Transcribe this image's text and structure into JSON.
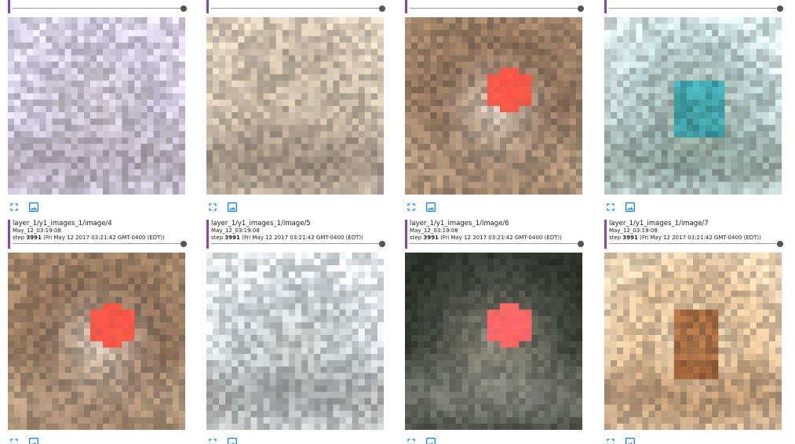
{
  "cards": [
    {
      "tag": "",
      "run": "",
      "step_num": "3991",
      "step_time": " (Fri May 12 2017 03:21:42 GMT-0400 (EDT))",
      "thumbnail": "face-gray-purple"
    },
    {
      "tag": "",
      "run": "",
      "step_num": "3991",
      "step_time": " (Fri May 12 2017 03:21:42 GMT-0400 (EDT))",
      "thumbnail": "face-beige-dark"
    },
    {
      "tag": "",
      "run": "",
      "step_num": "3991",
      "step_time": " (Fri May 12 2017 03:21:42 GMT-0400 (EDT))",
      "thumbnail": "face-brown-red-blob"
    },
    {
      "tag": "",
      "run": "",
      "step_num": "3991",
      "step_time": " (Fri May 12 2017 03:21:42 GMT-0400 (EDT))",
      "thumbnail": "blurry-teal-scene"
    },
    {
      "tag": "layer_1/y1_images_1/image/4",
      "run": "May_12_03:19:08",
      "step_num": "3991",
      "step_time": " (Fri May 12 2017 03:21:42 GMT-0400 (EDT))",
      "thumbnail": "face-brown-red-blob"
    },
    {
      "tag": "layer_1/y1_images_1/image/5",
      "run": "May_12_03:19:08",
      "step_num": "3991",
      "step_time": " (Fri May 12 2017 03:21:42 GMT-0400 (EDT))",
      "thumbnail": "face-gray-blue"
    },
    {
      "tag": "layer_1/y1_images_1/image/6",
      "run": "May_12_03:19:08",
      "step_num": "3991",
      "step_time": " (Fri May 12 2017 03:21:42 GMT-0400 (EDT))",
      "thumbnail": "face-dark-red-blob"
    },
    {
      "tag": "layer_1/y1_images_1/image/7",
      "run": "May_12_03:19:08",
      "step_num": "3991",
      "step_time": " (Fri May 12 2017 03:21:42 GMT-0400 (EDT))",
      "thumbnail": "face-tan-orange"
    }
  ],
  "labels": {
    "step_prefix": "step "
  },
  "icons": {
    "fullscreen": "fullscreen-icon",
    "actual_size": "image-icon"
  },
  "colors": {
    "accent": "#8e44ad",
    "icon": "#1e88e5",
    "slider_knob": "#555555",
    "slider_track": "#9e9e9e"
  }
}
